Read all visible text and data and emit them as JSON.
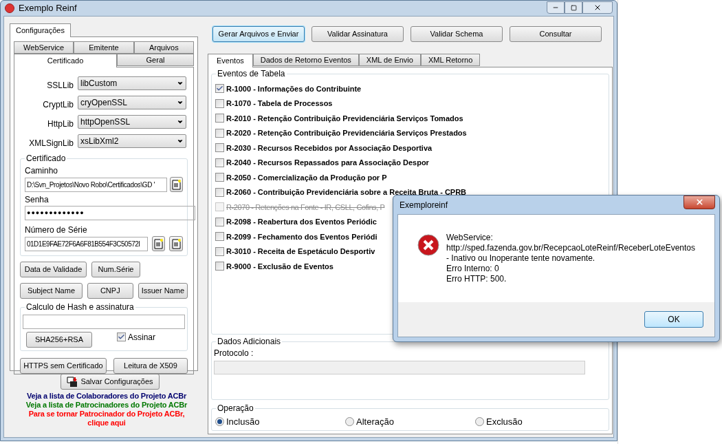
{
  "window": {
    "title": "Exemplo Reinf"
  },
  "config": {
    "outer_tab": {
      "label": "Configurações",
      "selected": true
    },
    "tab_rows": [
      [
        {
          "label": "WebService",
          "selected": false
        },
        {
          "label": "Emitente",
          "selected": false
        },
        {
          "label": "Arquivos",
          "selected": false
        }
      ],
      [
        {
          "label": "Certificado",
          "selected": true
        },
        {
          "label": "Geral",
          "selected": false
        }
      ]
    ],
    "selects": [
      {
        "label": "SSLLib",
        "value": "libCustom"
      },
      {
        "label": "CryptLib",
        "value": "cryOpenSSL"
      },
      {
        "label": "HttpLib",
        "value": "httpOpenSSL"
      },
      {
        "label": "XMLSignLib",
        "value": "xsLibXml2"
      }
    ],
    "certificado": {
      "title": "Certificado",
      "path_label": "Caminho",
      "path_value": "D:\\Svn_Projetos\\Novo Robo\\Certificados\\GD '",
      "password_label": "Senha",
      "password_value": "●●●●●●●●●●●●●",
      "serial_label": "Número de Série",
      "serial_value": "01D1E9FAE72F6A6F81B554F3C50572I"
    },
    "button_rows": [
      [
        "Data de Validade",
        "Num.Série"
      ],
      [
        "Subject Name",
        "CNPJ",
        "Issuer Name"
      ]
    ],
    "hash": {
      "title": "Calculo de Hash e assinatura",
      "button": "SHA256+RSA",
      "checkbox": {
        "label": "Assinar",
        "checked": true
      }
    },
    "bottom_buttons": [
      "HTTPS sem Certificado",
      "Leitura de X509"
    ],
    "save_button": "Salvar Configurações",
    "links": [
      {
        "text": "Veja a lista de Colaboradores do Projeto ACBr",
        "color": "#00006e"
      },
      {
        "text": "Veja a lista de Patrocinadores do Projeto ACBr",
        "color": "#007800"
      },
      {
        "text": "Para se tornar Patrocinador do Projeto ACBr, clique aqui",
        "color": "#ff0000"
      }
    ]
  },
  "toolbar": [
    {
      "label": "Gerar Arquivos e Enviar",
      "selected": true
    },
    {
      "label": "Validar Assinatura",
      "selected": false
    },
    {
      "label": "Validar Schema",
      "selected": false
    },
    {
      "label": "Consultar",
      "selected": false
    }
  ],
  "tabs": [
    {
      "label": "Eventos",
      "selected": true
    },
    {
      "label": "Dados de Retorno Eventos",
      "selected": false
    },
    {
      "label": "XML de Envio",
      "selected": false
    },
    {
      "label": "XML Retorno",
      "selected": false
    }
  ],
  "events": {
    "title": "Eventos de Tabela",
    "items": [
      {
        "label": "R-1000 - Informações do Contribuinte",
        "checked": true,
        "disabled": false
      },
      {
        "label": "R-1070 - Tabela de Processos",
        "checked": false,
        "disabled": false
      },
      {
        "label": "R-2010 - Retenção Contribuição Previdenciária  Serviços Tomados",
        "checked": false,
        "disabled": false
      },
      {
        "label": "R-2020 - Retenção Contribuição Previdenciária  Serviços Prestados",
        "checked": false,
        "disabled": false
      },
      {
        "label": "R-2030 - Recursos Recebidos por Associação Desportiva",
        "checked": false,
        "disabled": false
      },
      {
        "label": "R-2040 - Recursos Repassados para Associação Despor",
        "checked": false,
        "disabled": false
      },
      {
        "label": "R-2050 - Comercialização da Produção por P",
        "checked": false,
        "disabled": false
      },
      {
        "label": "R-2060 - Contribuição Previdenciária sobre a Receita Bruta - CPRB",
        "checked": false,
        "disabled": false
      },
      {
        "label": "R-2070 - Retenções na Fonte - IR, CSLL, Cofins, P",
        "checked": false,
        "disabled": true
      },
      {
        "label": "R-2098 - Reabertura dos Eventos Periódic",
        "checked": false,
        "disabled": false
      },
      {
        "label": "R-2099 - Fechamento dos Eventos Periódi",
        "checked": false,
        "disabled": false
      },
      {
        "label": "R-3010 - Receita de Espetáculo Desportiv",
        "checked": false,
        "disabled": false
      },
      {
        "label": "R-9000 - Exclusão de Eventos",
        "checked": false,
        "disabled": false
      }
    ]
  },
  "dados_adicionais": {
    "title": "Dados Adicionais",
    "protocolo_label": "Protocolo :"
  },
  "operacao": {
    "title": "Operação",
    "options": [
      {
        "label": "Inclusão",
        "selected": true
      },
      {
        "label": "Alteração",
        "selected": false
      },
      {
        "label": "Exclusão",
        "selected": false
      }
    ]
  },
  "dialog": {
    "title": "Exemploreinf",
    "lines": [
      "WebService:",
      "http://sped.fazenda.gov.br/RecepcaoLoteReinf/ReceberLoteEventos",
      "- Inativo ou Inoperante tente novamente.",
      "Erro Interno: 0",
      "Erro HTTP: 500."
    ],
    "button": "OK"
  }
}
